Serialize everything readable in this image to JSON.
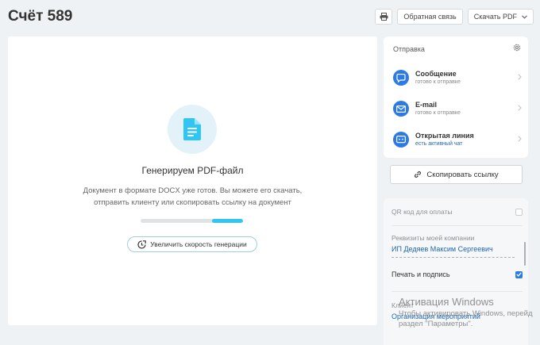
{
  "page": {
    "title": "Счёт 589"
  },
  "toolbar": {
    "print_icon": "printer-icon",
    "feedback_label": "Обратная связь",
    "download_label": "Скачать PDF",
    "download_caret_icon": "chevron-down-icon"
  },
  "generation": {
    "icon": "document-icon",
    "title": "Генерируем PDF-файл",
    "desc_line1": "Документ в формате DOCX уже готов. Вы можете его скачать,",
    "desc_line2": "отправить клиенту или скопировать ссылку на документ",
    "progress_fraction": 0.4,
    "speed_button_label": "Увеличить скорость генерации",
    "accent_color": "#2fc6f6"
  },
  "send": {
    "header": "Отправка",
    "channels": [
      {
        "name": "Сообщение",
        "status": "готово к отправке",
        "icon": "chat-icon"
      },
      {
        "name": "E-mail",
        "status": "готово к отправке",
        "icon": "mail-icon"
      },
      {
        "name": "Открытая линия",
        "status": "есть активный чат",
        "icon": "open-line-icon"
      }
    ],
    "channel_icon_color": "#2c7be5"
  },
  "copy_link": {
    "label": "Скопировать ссылку"
  },
  "settings": {
    "qr_label": "QR код для оплаты",
    "qr_checked": false,
    "requisites_label": "Реквизиты моей компании",
    "requisites_value": "ИП Дедяев Максим Сергеевич",
    "sign_label": "Печать и подпись",
    "sign_checked": true,
    "client_label": "Клиент",
    "client_value": "Организация мероприятий"
  },
  "watermark": {
    "title": "Активация Windows",
    "line1": "Чтобы активировать Windows, перейд",
    "line2": "раздел \"Параметры\"."
  }
}
